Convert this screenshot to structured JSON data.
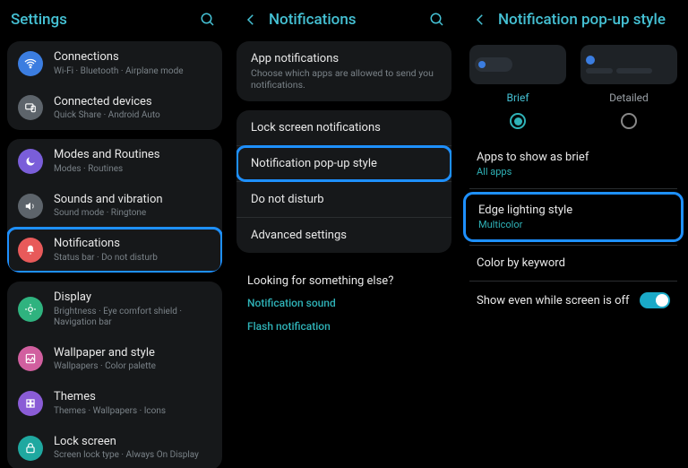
{
  "pane1": {
    "title": "Settings",
    "groups": [
      [
        {
          "icon": "wifi",
          "color": "ic-blue",
          "title": "Connections",
          "sub": "Wi-Fi · Bluetooth · Airplane mode"
        },
        {
          "icon": "device",
          "color": "ic-gray",
          "title": "Connected devices",
          "sub": "Quick Share · Android Auto"
        }
      ],
      [
        {
          "icon": "moon",
          "color": "ic-purple",
          "title": "Modes and Routines",
          "sub": "Modes · Routines"
        },
        {
          "icon": "sound",
          "color": "ic-gray",
          "title": "Sounds and vibration",
          "sub": "Sound mode · Ringtone"
        },
        {
          "icon": "bell",
          "color": "ic-red",
          "title": "Notifications",
          "sub": "Status bar · Do not disturb",
          "highlight": true
        }
      ],
      [
        {
          "icon": "display",
          "color": "ic-green",
          "title": "Display",
          "sub": "Brightness · Eye comfort shield · Navigation bar"
        },
        {
          "icon": "wallpaper",
          "color": "ic-pink",
          "title": "Wallpaper and style",
          "sub": "Wallpapers · Color palette"
        },
        {
          "icon": "themes",
          "color": "ic-violet",
          "title": "Themes",
          "sub": "Themes · Wallpapers · Icons"
        },
        {
          "icon": "lock",
          "color": "ic-teal",
          "title": "Lock screen",
          "sub": "Screen lock type · Always On Display"
        }
      ]
    ]
  },
  "pane2": {
    "title": "Notifications",
    "items": [
      {
        "title": "App notifications",
        "sub": "Choose which apps are allowed to send you notifications."
      }
    ],
    "group": [
      {
        "title": "Lock screen notifications"
      },
      {
        "title": "Notification pop-up style",
        "highlight": true
      },
      {
        "title": "Do not disturb"
      },
      {
        "title": "Advanced settings"
      }
    ],
    "looking": "Looking for something else?",
    "links": [
      "Notification sound",
      "Flash notification"
    ]
  },
  "pane3": {
    "title": "Notification pop-up style",
    "styles": [
      {
        "label": "Brief",
        "selected": true
      },
      {
        "label": "Detailed",
        "selected": false
      }
    ],
    "items": [
      {
        "title": "Apps to show as brief",
        "sub": "All apps"
      },
      {
        "title": "Edge lighting style",
        "sub": "Multicolor",
        "highlight": true
      },
      {
        "title": "Color by keyword"
      }
    ],
    "toggle": {
      "label": "Show even while screen is off",
      "on": true
    }
  }
}
